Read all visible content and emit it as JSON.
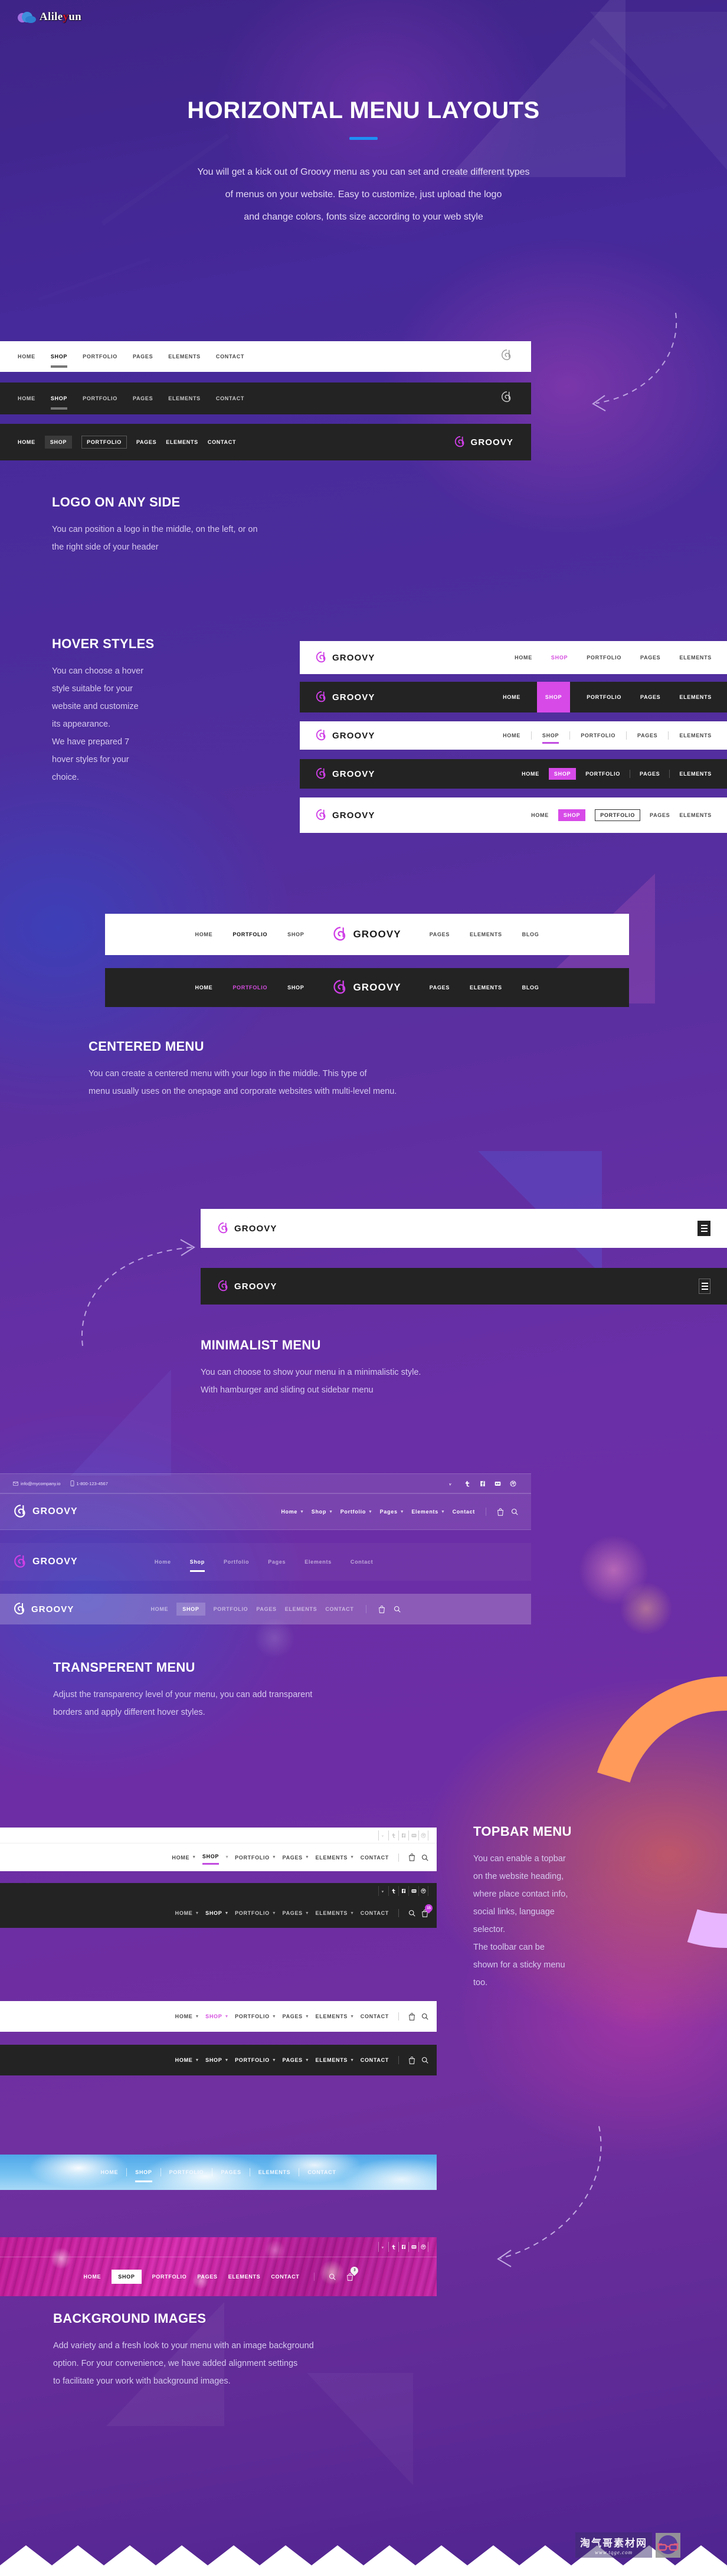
{
  "site_logo": {
    "text_part1": "Alile",
    "text_highlight": "y",
    "text_part2": "un",
    "icon": "cloud-icon"
  },
  "hero": {
    "title": "HORIZONTAL MENU LAYOUTS",
    "accent_color": "#1f8ff5",
    "paragraph_lines": [
      "You will get a kick out of Groovy menu as you can set and create different types",
      "of menus on your website. Easy to customize, just upload the logo",
      "and change colors, fonts size according to your web style"
    ]
  },
  "brand": {
    "name": "GROOVY",
    "mark_color": "#cf3fe6"
  },
  "nav_items": [
    "HOME",
    "SHOP",
    "PORTFOLIO",
    "PAGES",
    "ELEMENTS",
    "CONTACT"
  ],
  "nav_items_mixed": [
    "Home",
    "Shop",
    "Portfolio",
    "Pages",
    "Elements",
    "Contact"
  ],
  "logo_side_section": {
    "title": "LOGO ON ANY SIDE",
    "body_lines": [
      "You can position a logo in the middle, on the left, or on",
      "the right side of your header"
    ],
    "bars": [
      {
        "style": "white",
        "items": [
          "HOME",
          "SHOP",
          "PORTFOLIO",
          "PAGES",
          "ELEMENTS",
          "CONTACT"
        ],
        "active": "SHOP",
        "logo_side": "right",
        "logo_text_visible": false
      },
      {
        "style": "dark",
        "items": [
          "HOME",
          "SHOP",
          "PORTFOLIO",
          "PAGES",
          "ELEMENTS",
          "CONTACT"
        ],
        "active": "SHOP",
        "logo_side": "right",
        "logo_text_visible": false
      },
      {
        "style": "dark",
        "items": [
          "HOME",
          "SHOP",
          "PORTFOLIO",
          "PAGES",
          "ELEMENTS",
          "CONTACT"
        ],
        "active": "SHOP",
        "logo_side": "right",
        "logo_text_visible": true
      }
    ]
  },
  "hover_section": {
    "title": "HOVER STYLES",
    "body_lines": [
      "You can choose a hover",
      "style suitable for your",
      "website and customize",
      "its appearance.",
      "We have prepared 7",
      "hover styles for your",
      "choice."
    ],
    "bars": [
      {
        "style": "white",
        "hover": "text-color",
        "items": [
          "HOME",
          "SHOP",
          "PORTFOLIO",
          "PAGES",
          "ELEMENTS"
        ],
        "active": "SHOP"
      },
      {
        "style": "dark",
        "hover": "full-height-fill",
        "items": [
          "HOME",
          "SHOP",
          "PORTFOLIO",
          "PAGES",
          "ELEMENTS"
        ],
        "active": "SHOP"
      },
      {
        "style": "white",
        "hover": "underline",
        "items": [
          "HOME",
          "SHOP",
          "PORTFOLIO",
          "PAGES",
          "ELEMENTS"
        ],
        "active": "SHOP"
      },
      {
        "style": "dark",
        "hover": "block-fill",
        "items": [
          "HOME",
          "SHOP",
          "PORTFOLIO",
          "PAGES",
          "ELEMENTS"
        ],
        "active": "SHOP"
      },
      {
        "style": "white",
        "hover": "fill-and-outline",
        "items": [
          "HOME",
          "SHOP",
          "PORTFOLIO",
          "PAGES",
          "ELEMENTS"
        ],
        "active": "SHOP",
        "outlined": "PORTFOLIO"
      }
    ]
  },
  "centered_section": {
    "title": "CENTERED MENU",
    "body_lines": [
      "You can create a centered menu with your logo in the middle. This type of",
      "menu usually uses on the onepage and corporate websites with multi-level menu."
    ],
    "left_items": [
      "HOME",
      "PORTFOLIO",
      "SHOP"
    ],
    "right_items": [
      "PAGES",
      "ELEMENTS",
      "BLOG"
    ],
    "active": "PORTFOLIO",
    "bars": [
      {
        "style": "white",
        "active_color": "#111111"
      },
      {
        "style": "dark",
        "active_color": "#d54de0"
      }
    ]
  },
  "minimalist_section": {
    "title": "MINIMALIST MENU",
    "body_lines": [
      "You can choose to show your menu in a minimalistic style.",
      "With hamburger and sliding out sidebar menu"
    ],
    "bars": [
      {
        "style": "white",
        "icon": "hamburger-icon",
        "icon_variant": "boxed"
      },
      {
        "style": "dark",
        "icon": "hamburger-icon",
        "icon_variant": "outlined"
      }
    ]
  },
  "transparent_section": {
    "title": "TRANSPERENT MENU",
    "body_lines": [
      "Adjust the transparency level of your menu, you can add transparent",
      "borders and apply different hover styles."
    ],
    "topbar": {
      "email": "info@mycompany.io",
      "phone": "1-800-123-4567",
      "email_icon": "mail-icon",
      "phone_icon": "phone-icon",
      "socials": [
        "vimeo-icon",
        "tumblr-icon",
        "facebook-icon",
        "flickr-icon",
        "dribbble-icon"
      ]
    },
    "bars": [
      {
        "opacity": "light",
        "items": [
          "Home",
          "Shop",
          "Portfolio",
          "Pages",
          "Elements",
          "Contact"
        ],
        "active": "Shop",
        "carets": true,
        "tools": [
          "cart-icon",
          "search-icon"
        ]
      },
      {
        "opacity": "lighter",
        "items": [
          "Home",
          "Shop",
          "Portfolio",
          "Pages",
          "Elements",
          "Contact"
        ],
        "active": "Shop",
        "carets": false,
        "tools": []
      },
      {
        "opacity": "strong",
        "items": [
          "HOME",
          "SHOP",
          "PORTFOLIO",
          "PAGES",
          "ELEMENTS",
          "CONTACT"
        ],
        "active": "SHOP",
        "carets": false,
        "tools": [
          "cart-icon",
          "search-icon"
        ]
      }
    ]
  },
  "topbar_section": {
    "title": "TOPBAR MENU",
    "body_lines": [
      "You can enable a topbar",
      "on the website heading,",
      "where place contact info,",
      "social links, language",
      "selector.",
      "The toolbar can be",
      "shown for a sticky menu",
      "too."
    ],
    "socials": [
      "vimeo-icon",
      "tumblr-icon",
      "facebook-icon",
      "flickr-icon",
      "dribbble-icon"
    ],
    "bars": [
      {
        "style": "white",
        "items": [
          "HOME",
          "SHOP",
          "PORTFOLIO",
          "PAGES",
          "ELEMENTS",
          "CONTACT"
        ],
        "active": "SHOP",
        "active_color": "#111111",
        "tools": [
          "cart-icon",
          "search-icon"
        ],
        "badge": null,
        "topbar": true
      },
      {
        "style": "dark",
        "items": [
          "HOME",
          "SHOP",
          "PORTFOLIO",
          "PAGES",
          "ELEMENTS",
          "CONTACT"
        ],
        "active": "SHOP",
        "active_color": "#ffffff",
        "tools": [
          "search-icon",
          "cart-icon"
        ],
        "badge": "15",
        "topbar": true
      },
      {
        "style": "white",
        "items": [
          "HOME",
          "SHOP",
          "PORTFOLIO",
          "PAGES",
          "ELEMENTS",
          "CONTACT"
        ],
        "active": "SHOP",
        "active_color": "#d54de0",
        "tools": [
          "cart-icon",
          "search-icon"
        ],
        "badge": null,
        "topbar": false
      },
      {
        "style": "dark",
        "items": [
          "HOME",
          "SHOP",
          "PORTFOLIO",
          "PAGES",
          "ELEMENTS",
          "CONTACT"
        ],
        "active": "SHOP",
        "active_color": "#ffffff",
        "tools": [
          "cart-icon",
          "search-icon"
        ],
        "badge": null,
        "topbar": false
      }
    ]
  },
  "background_section": {
    "title": "BACKGROUND IMAGES",
    "body_lines": [
      "Add variety and a fresh look to your menu with an image background",
      "option. For your convenience, we have added alignment settings",
      "to facilitate your work with background images."
    ],
    "bars": [
      {
        "image": "sky-clouds",
        "items": [
          "HOME",
          "SHOP",
          "PORTFOLIO",
          "PAGES",
          "ELEMENTS",
          "CONTACT"
        ],
        "active": "SHOP",
        "hover": "underline",
        "tools": [],
        "badge": null
      },
      {
        "image": "pink-flowers",
        "items": [
          "HOME",
          "SHOP",
          "PORTFOLIO",
          "PAGES",
          "ELEMENTS",
          "CONTACT"
        ],
        "active": "SHOP",
        "hover": "white-fill",
        "tools": [
          "search-icon",
          "cart-icon"
        ],
        "badge": "3",
        "socials": [
          "vimeo-icon",
          "tumblr-icon",
          "facebook-icon",
          "flickr-icon",
          "dribbble-icon"
        ]
      }
    ]
  },
  "watermark": {
    "cn_text": "淘气哥素材网",
    "url": "www.tqge.com",
    "icon": "glasses-icon"
  }
}
